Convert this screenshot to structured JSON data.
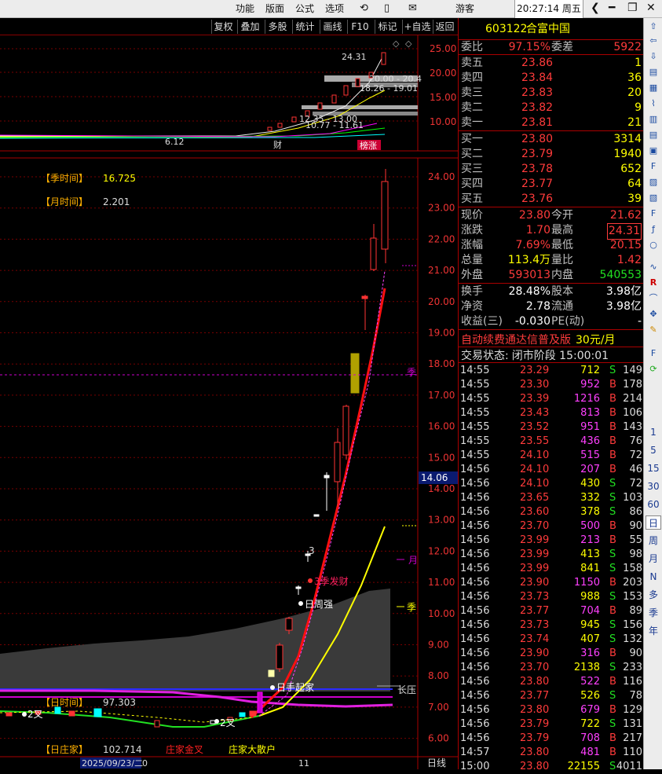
{
  "menu": {
    "items": [
      "功能",
      "版面",
      "公式",
      "选项"
    ],
    "user": "游客",
    "time": "20:27:14 周五"
  },
  "toolbar": {
    "buttons": [
      "复权",
      "叠加",
      "多股",
      "统计",
      "画线",
      "F10",
      "标记",
      "+自选",
      "返回"
    ]
  },
  "stock": {
    "code": "603122",
    "name": "合富中国"
  },
  "weibi": {
    "label": "委比",
    "value": "97.15%",
    "label2": "委差",
    "value2": "5922"
  },
  "asks": [
    {
      "label": "卖五",
      "price": "23.86",
      "vol": "1"
    },
    {
      "label": "卖四",
      "price": "23.84",
      "vol": "36"
    },
    {
      "label": "卖三",
      "price": "23.83",
      "vol": "20"
    },
    {
      "label": "卖二",
      "price": "23.82",
      "vol": "9"
    },
    {
      "label": "卖一",
      "price": "23.81",
      "vol": "21"
    }
  ],
  "bids": [
    {
      "label": "买一",
      "price": "23.80",
      "vol": "3314"
    },
    {
      "label": "买二",
      "price": "23.79",
      "vol": "1940"
    },
    {
      "label": "买三",
      "price": "23.78",
      "vol": "652"
    },
    {
      "label": "买四",
      "price": "23.77",
      "vol": "64"
    },
    {
      "label": "买五",
      "price": "23.76",
      "vol": "39"
    }
  ],
  "stats": [
    {
      "l1": "现价",
      "v1": "23.80",
      "c1": "red",
      "l2": "今开",
      "v2": "21.62",
      "c2": "red"
    },
    {
      "l1": "涨跌",
      "v1": "1.70",
      "c1": "red",
      "l2": "最高",
      "v2": "24.31",
      "c2": "red"
    },
    {
      "l1": "涨幅",
      "v1": "7.69%",
      "c1": "red",
      "l2": "最低",
      "v2": "20.15",
      "c2": "red"
    },
    {
      "l1": "总量",
      "v1": "113.4万",
      "c1": "yellow",
      "l2": "量比",
      "v2": "1.42",
      "c2": "red"
    },
    {
      "l1": "外盘",
      "v1": "593013",
      "c1": "red",
      "l2": "内盘",
      "v2": "540553",
      "c2": "green"
    }
  ],
  "stats2": [
    {
      "l1": "换手",
      "v1": "28.48%",
      "l2": "股本",
      "v2": "3.98亿"
    },
    {
      "l1": "净资",
      "v1": "2.78",
      "l2": "流通",
      "v2": "3.98亿"
    },
    {
      "l1": "收益(三)",
      "v1": "-0.030",
      "l2": "PE(动)",
      "v2": "-"
    }
  ],
  "ad": {
    "text": "自动续费通达信普及版",
    "price": "30元/月"
  },
  "trade_state": {
    "label": "交易状态:",
    "value": "闭市阶段 15:00:01"
  },
  "ticks": [
    [
      "14:55",
      "23.29",
      "712",
      "S",
      "149"
    ],
    [
      "14:55",
      "23.30",
      "952",
      "B",
      "178"
    ],
    [
      "14:55",
      "23.39",
      "1216",
      "B",
      "214"
    ],
    [
      "14:55",
      "23.43",
      "813",
      "B",
      "106"
    ],
    [
      "14:55",
      "23.52",
      "951",
      "B",
      "143"
    ],
    [
      "14:55",
      "23.55",
      "436",
      "B",
      "76"
    ],
    [
      "14:55",
      "24.10",
      "515",
      "B",
      "72"
    ],
    [
      "14:56",
      "24.10",
      "207",
      "B",
      "46"
    ],
    [
      "14:56",
      "24.10",
      "430",
      "S",
      "72"
    ],
    [
      "14:56",
      "23.65",
      "332",
      "S",
      "103"
    ],
    [
      "14:56",
      "23.60",
      "378",
      "S",
      "86"
    ],
    [
      "14:56",
      "23.70",
      "500",
      "B",
      "90"
    ],
    [
      "14:56",
      "23.99",
      "213",
      "B",
      "55"
    ],
    [
      "14:56",
      "23.99",
      "413",
      "S",
      "98"
    ],
    [
      "14:56",
      "23.99",
      "841",
      "S",
      "158"
    ],
    [
      "14:56",
      "23.90",
      "1150",
      "B",
      "203"
    ],
    [
      "14:56",
      "23.73",
      "988",
      "S",
      "153"
    ],
    [
      "14:56",
      "23.77",
      "704",
      "B",
      "89"
    ],
    [
      "14:56",
      "23.73",
      "945",
      "S",
      "156"
    ],
    [
      "14:56",
      "23.74",
      "407",
      "S",
      "132"
    ],
    [
      "14:56",
      "23.90",
      "316",
      "B",
      "90"
    ],
    [
      "14:56",
      "23.70",
      "2138",
      "S",
      "233"
    ],
    [
      "14:56",
      "23.80",
      "522",
      "B",
      "116"
    ],
    [
      "14:56",
      "23.77",
      "526",
      "S",
      "78"
    ],
    [
      "14:56",
      "23.80",
      "679",
      "B",
      "129"
    ],
    [
      "14:56",
      "23.79",
      "722",
      "S",
      "131"
    ],
    [
      "14:56",
      "23.79",
      "708",
      "B",
      "217"
    ],
    [
      "14:57",
      "23.80",
      "481",
      "B",
      "110"
    ],
    [
      "15:00",
      "23.80",
      "22155",
      "S",
      "4011"
    ]
  ],
  "upper_chart": {
    "yticks": [
      "25.00",
      "20.00",
      "15.00",
      "10.00"
    ],
    "labels": {
      "hi": "24.31",
      "lo": "6.12",
      "r1": "20.00 - 20.4",
      "r2": "18.26 - 19.01",
      "r3": "12.35 - 13.00",
      "r4": "10.77 - 11.61",
      "cai": "财",
      "bang": "榜涨"
    }
  },
  "lower_chart": {
    "yticks": [
      "24.00",
      "23.00",
      "22.00",
      "21.00",
      "20.00",
      "19.00",
      "18.00",
      "17.00",
      "16.00",
      "15.00",
      "14.00",
      "13.00",
      "12.00",
      "11.00",
      "10.00",
      "9.00",
      "8.00",
      "7.00",
      "6.00"
    ],
    "cursor_price": "14.06",
    "indicators": [
      {
        "label": "【季时间】",
        "value": "16.725"
      },
      {
        "label": "【月时间】",
        "value": "2.201"
      }
    ],
    "annotations": {
      "jifacai": "3季发财",
      "rizhouqiang": "日周强",
      "shouqijia": "日手起家",
      "changya": "长压",
      "ji": "季",
      "yue": "月",
      "ji2": "季",
      "three": "3",
      "erjiao1": "2叉",
      "erjiao2": "2叉"
    },
    "bottom": {
      "rishijian": "【日时间】",
      "rishijian_val": "97.303",
      "rizhuangjia": "【日庄家】",
      "rizhuangjia_val": "102.714",
      "zhuangjinjiao": "庄家金叉",
      "dasanhu": "庄家大散户",
      "date": "2025/09/23/二",
      "month": "11",
      "period": "日线"
    }
  },
  "side_periods": [
    "1",
    "5",
    "15",
    "30",
    "60",
    "日",
    "周",
    "月",
    "N",
    "多",
    "季",
    "年"
  ]
}
